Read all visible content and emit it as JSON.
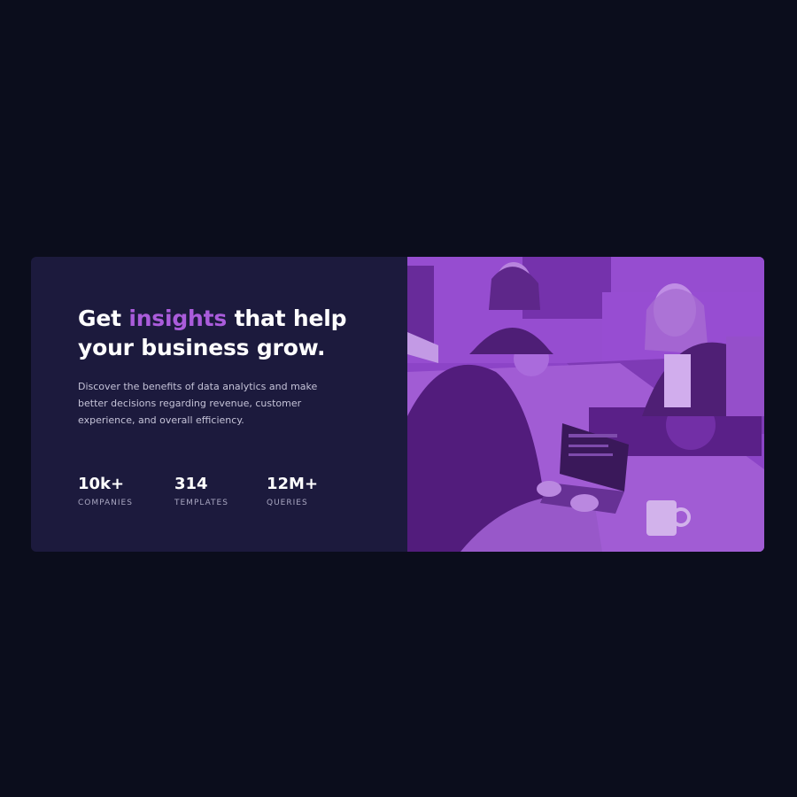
{
  "hero": {
    "headline_pre": "Get ",
    "headline_accent": "insights",
    "headline_post": " that help your business grow.",
    "description": "Discover the benefits of data analytics and make better decisions regarding revenue, customer experience, and overall efficiency.",
    "accent_color": "#aa5cdb"
  },
  "stats": [
    {
      "value": "10k+",
      "label": "COMPANIES"
    },
    {
      "value": "314",
      "label": "TEMPLATES"
    },
    {
      "value": "12M+",
      "label": "QUERIES"
    }
  ],
  "image": {
    "description": "image-team-working-at-desks",
    "overlay_color": "#8a3fd0"
  }
}
